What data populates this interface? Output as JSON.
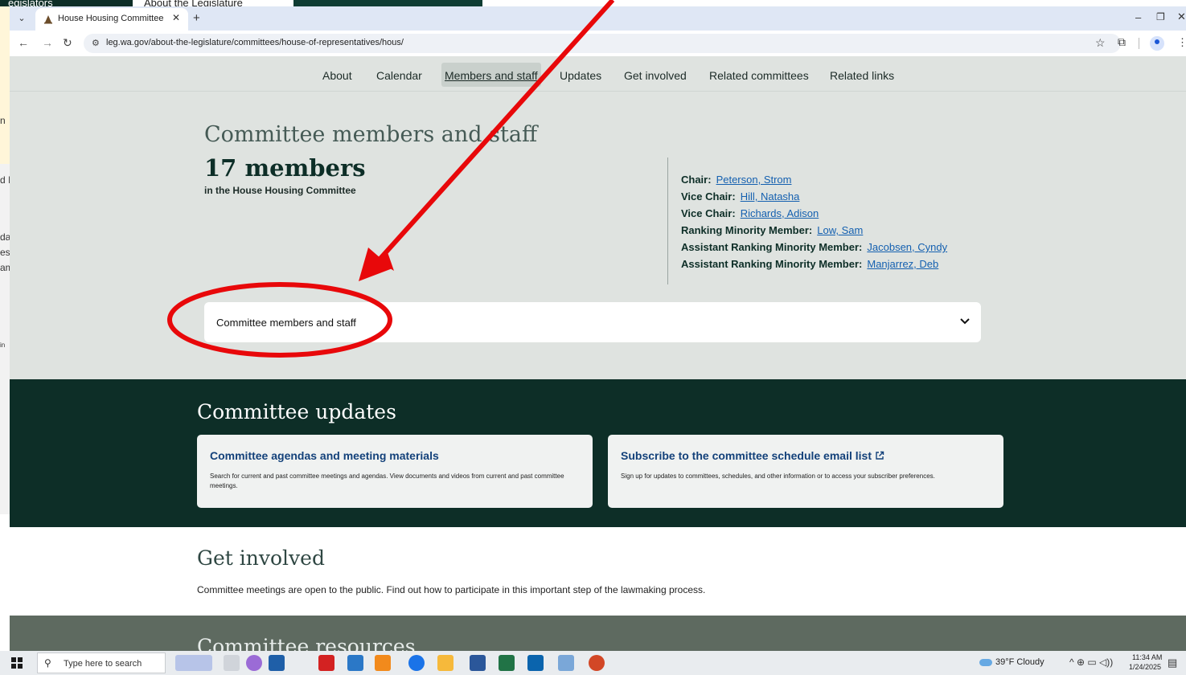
{
  "background_window": {
    "tab1": "egislators",
    "tab2": "About the Legislature",
    "fragments": [
      "n",
      "d I",
      "da",
      "ess",
      "am",
      "in"
    ]
  },
  "browser": {
    "tab_title": "House Housing Committee",
    "url": "leg.wa.gov/about-the-legislature/committees/house-of-representatives/hous/",
    "icons": {
      "tab_list": "chevron-down-icon",
      "close": "close-icon",
      "new_tab": "plus-icon",
      "back": "arrow-left-icon",
      "forward": "arrow-right-icon",
      "reload": "reload-icon",
      "bookmark": "star-icon",
      "extensions": "puzzle-icon"
    }
  },
  "subnav": {
    "items": [
      "About",
      "Calendar",
      "Members and staff",
      "Updates",
      "Get involved",
      "Related committees",
      "Related links"
    ],
    "active": "Members and staff"
  },
  "members": {
    "heading": "Committee members and staff",
    "count": "17 members",
    "subtext": "in the House Housing Committee",
    "leadership": [
      {
        "role": "Chair:",
        "name": "Peterson, Strom"
      },
      {
        "role": "Vice Chair:",
        "name": "Hill, Natasha"
      },
      {
        "role": "Vice Chair:",
        "name": "Richards, Adison"
      },
      {
        "role": "Ranking Minority Member:",
        "name": "Low, Sam"
      },
      {
        "role": "Assistant Ranking Minority Member:",
        "name": "Jacobsen, Cyndy"
      },
      {
        "role": "Assistant Ranking Minority Member:",
        "name": "Manjarrez, Deb"
      }
    ],
    "accordion_label": "Committee members and staff"
  },
  "updates": {
    "heading": "Committee updates",
    "cards": [
      {
        "title": "Committee agendas and meeting materials",
        "desc": "Search for current and past committee meetings and agendas. View documents and videos from current and past committee meetings."
      },
      {
        "title": "Subscribe to the committee schedule email list",
        "desc": "Sign up for updates to committees, schedules, and other information or to access your subscriber preferences."
      }
    ]
  },
  "get_involved": {
    "heading": "Get involved",
    "text": "Committee meetings are open to the public. Find out how to participate in this important step of the lawmaking process."
  },
  "resources": {
    "heading": "Committee resources"
  },
  "taskbar": {
    "search_placeholder": "Type here to search",
    "weather": "39°F  Cloudy",
    "time": "11:34 AM",
    "date": "1/24/2025"
  },
  "colors": {
    "accent_dark": "#0d2e27",
    "link": "#1460b0",
    "annotation": "#e8080a"
  }
}
